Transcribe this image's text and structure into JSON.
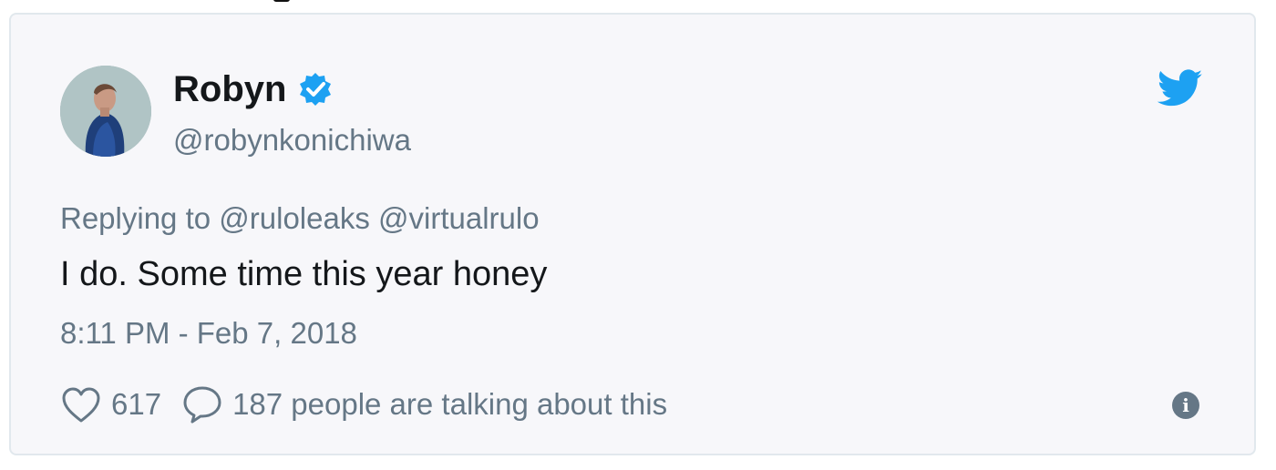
{
  "tweet": {
    "author_name": "Robyn",
    "author_handle": "@robynkonichiwa",
    "reply_prefix": "Replying to",
    "reply_to": "@ruloleaks @virtualrulo",
    "text": "I do. Some time this year honey",
    "timestamp": "8:11 PM - Feb 7, 2018",
    "like_count": "617",
    "talking_text": "187 people are talking about this"
  },
  "icons": {
    "verified": "verified-badge-icon",
    "bird": "twitter-bird-icon",
    "like": "heart-icon",
    "reply": "speech-bubble-icon",
    "info": "info-icon"
  },
  "colors": {
    "brand_blue": "#1da1f2",
    "text_primary": "#14171a",
    "text_secondary": "#657786"
  }
}
